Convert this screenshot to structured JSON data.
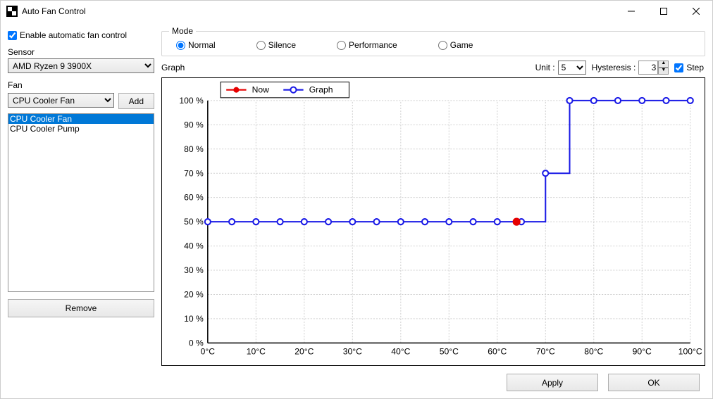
{
  "window": {
    "title": "Auto Fan Control",
    "minimize": "–",
    "maximize": "☐",
    "close": "✕"
  },
  "enable_auto_label": "Enable automatic fan control",
  "enable_auto_checked": true,
  "sensor_label": "Sensor",
  "sensor_value": "AMD Ryzen 9 3900X",
  "fan_label": "Fan",
  "fan_value": "CPU Cooler Fan",
  "add_label": "Add",
  "fan_list": [
    {
      "label": "CPU Cooler Fan",
      "selected": true
    },
    {
      "label": "CPU Cooler Pump",
      "selected": false
    }
  ],
  "remove_label": "Remove",
  "mode": {
    "legend": "Mode",
    "options": [
      "Normal",
      "Silence",
      "Performance",
      "Game"
    ],
    "selected": "Normal"
  },
  "graph": {
    "label": "Graph",
    "unit_label": "Unit :",
    "unit_value": "5",
    "hyst_label": "Hysteresis :",
    "hyst_value": "3",
    "step_label": "Step",
    "step_checked": true,
    "legend_now": "Now",
    "legend_graph": "Graph"
  },
  "buttons": {
    "apply": "Apply",
    "ok": "OK"
  },
  "chart_data": {
    "type": "line",
    "xlabel": "°C",
    "ylabel": "%",
    "xlim": [
      0,
      100
    ],
    "ylim": [
      0,
      100
    ],
    "x_ticks": [
      0,
      10,
      20,
      30,
      40,
      50,
      60,
      70,
      80,
      90,
      100
    ],
    "y_ticks": [
      0,
      10,
      20,
      30,
      40,
      50,
      60,
      70,
      80,
      90,
      100
    ],
    "x": [
      0,
      5,
      10,
      15,
      20,
      25,
      30,
      35,
      40,
      45,
      50,
      55,
      60,
      65,
      70,
      75,
      80,
      85,
      90,
      95,
      100
    ],
    "values": [
      50,
      50,
      50,
      50,
      50,
      50,
      50,
      50,
      50,
      50,
      50,
      50,
      50,
      50,
      70,
      100,
      100,
      100,
      100,
      100,
      100
    ],
    "now": {
      "x": 64,
      "y": 50
    },
    "step": true
  }
}
